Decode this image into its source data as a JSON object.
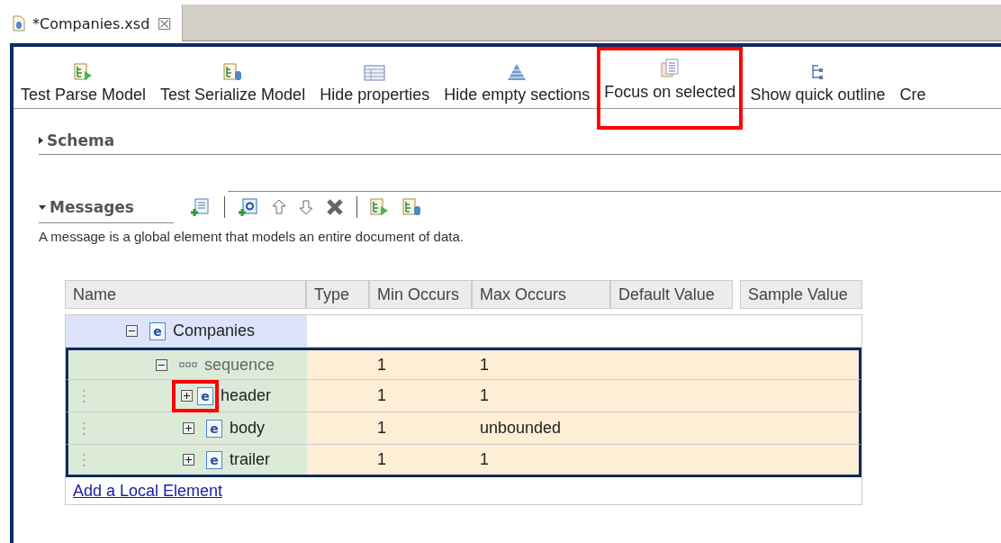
{
  "editor_tab": {
    "title": "*Companies.xsd",
    "close": "☒"
  },
  "toolbar": [
    {
      "label": "Test Parse Model",
      "highlighted": false
    },
    {
      "label": "Test Serialize Model",
      "highlighted": false
    },
    {
      "label": "Hide properties",
      "highlighted": false
    },
    {
      "label": "Hide empty sections",
      "highlighted": false
    },
    {
      "label": "Focus on selected",
      "highlighted": true
    },
    {
      "label": "Show quick outline",
      "highlighted": false
    },
    {
      "label": "Cre",
      "highlighted": false
    }
  ],
  "sections": [
    {
      "title": "Schema",
      "expanded": false
    },
    {
      "title": "Messages",
      "expanded": true
    }
  ],
  "messages": {
    "description": "A message is a global element that models an entire document of data.",
    "table": {
      "columns": [
        "Name",
        "Type",
        "Min Occurs",
        "Max Occurs",
        "Default Value",
        "Sample Value"
      ],
      "rows": [
        {
          "kind": "element",
          "name": "Companies",
          "badge": "e",
          "expanded": true,
          "selected": true,
          "focused": false,
          "movable": false,
          "toggle_highlighted": false,
          "min": "",
          "max": "",
          "children": [
            {
              "kind": "sequence",
              "name": "sequence",
              "expanded": true,
              "selected": false,
              "focused": true,
              "movable": false,
              "toggle_highlighted": false,
              "min": "1",
              "max": "1",
              "children": [
                {
                  "kind": "element",
                  "name": "header",
                  "badge": "e",
                  "expanded": false,
                  "selected": false,
                  "focused": true,
                  "movable": true,
                  "toggle_highlighted": true,
                  "min": "1",
                  "max": "1"
                },
                {
                  "kind": "element",
                  "name": "body",
                  "badge": "e",
                  "expanded": false,
                  "selected": false,
                  "focused": true,
                  "movable": true,
                  "toggle_highlighted": false,
                  "min": "1",
                  "max": "unbounded"
                },
                {
                  "kind": "element",
                  "name": "trailer",
                  "badge": "e",
                  "expanded": false,
                  "selected": false,
                  "focused": true,
                  "movable": true,
                  "toggle_highlighted": false,
                  "min": "1",
                  "max": "1"
                }
              ]
            }
          ]
        }
      ],
      "add_link": "Add a Local Element"
    }
  }
}
